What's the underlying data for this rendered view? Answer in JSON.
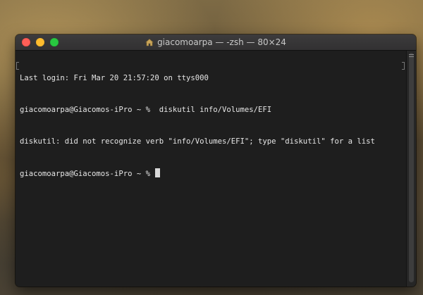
{
  "window": {
    "title": "giacomoarpa — -zsh — 80×24",
    "title_icon": "home-folder-icon"
  },
  "terminal": {
    "lines": [
      "Last login: Fri Mar 20 21:57:20 on ttys000",
      "giacomoarpa@Giacomos-iPro ~ %  diskutil info/Volumes/EFI",
      "diskutil: did not recognize verb \"info/Volumes/EFI\"; type \"diskutil\" for a list",
      "giacomoarpa@Giacomos-iPro ~ % "
    ]
  },
  "colors": {
    "close": "#fe5f57",
    "minimize": "#febc2e",
    "zoom": "#28c840",
    "terminal_bg": "#1e1e1e",
    "terminal_text": "#e6e6e6"
  }
}
